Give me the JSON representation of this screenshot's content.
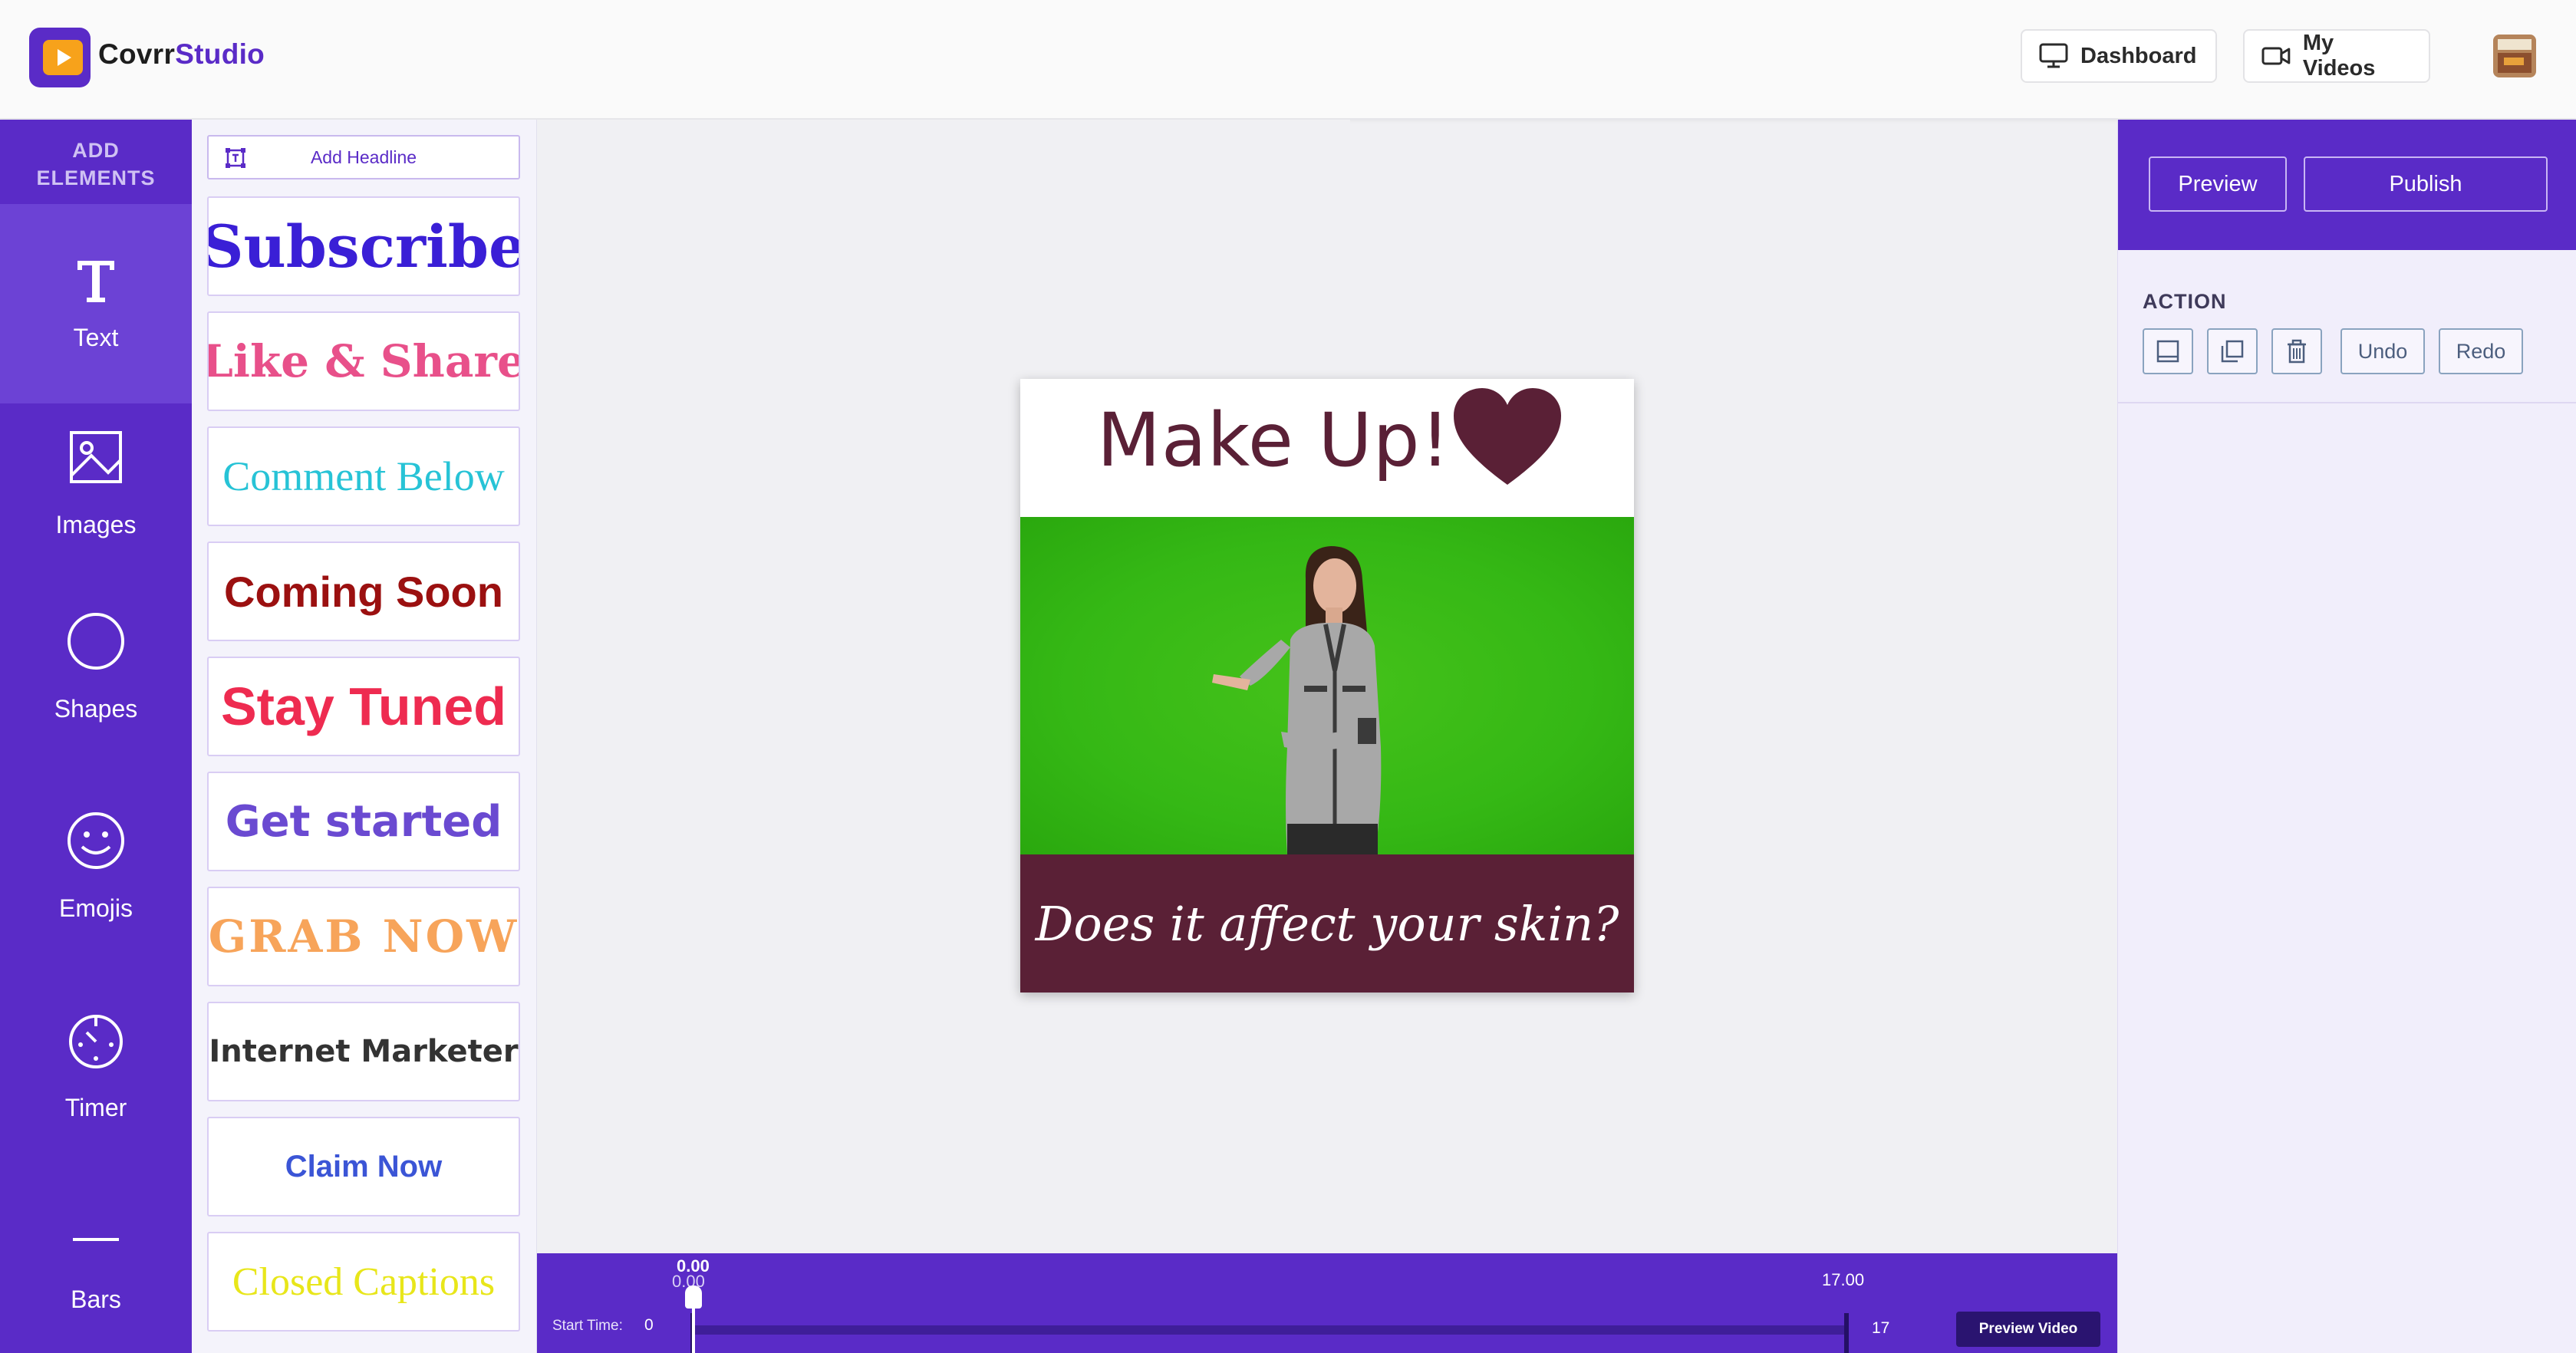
{
  "app": {
    "brand_left": "Covrr",
    "brand_right": "Studio"
  },
  "header": {
    "dashboard_label": "Dashboard",
    "my_videos_label": "My Videos"
  },
  "sidebar": {
    "heading_line1": "ADD",
    "heading_line2": "ELEMENTS",
    "items": [
      {
        "label": "Text",
        "icon": "text-icon"
      },
      {
        "label": "Images",
        "icon": "image-icon"
      },
      {
        "label": "Shapes",
        "icon": "circle-icon"
      },
      {
        "label": "Emojis",
        "icon": "smiley-icon"
      },
      {
        "label": "Timer",
        "icon": "timer-icon"
      },
      {
        "label": "Bars",
        "icon": "bar-icon"
      }
    ]
  },
  "panel": {
    "add_headline_label": "Add Headline",
    "templates": [
      {
        "text": "Subscribe",
        "color": "#3a1fd6"
      },
      {
        "text": "Like & Share",
        "color": "#e8508a"
      },
      {
        "text": "Comment Below",
        "color": "#27c3d6"
      },
      {
        "text": "Coming Soon",
        "color": "#9b1010"
      },
      {
        "text": "Stay Tuned",
        "color": "#ee2b50"
      },
      {
        "text": "Get started",
        "color": "#6a4ad1"
      },
      {
        "text": "GRAB NOW",
        "color": "#f7a45a"
      },
      {
        "text": "Internet Marketer",
        "color": "#333333"
      },
      {
        "text": "Claim Now",
        "color": "#3b55d6"
      },
      {
        "text": "Closed Captions",
        "color": "#e8e61a"
      }
    ]
  },
  "canvas": {
    "title": "Make Up!",
    "caption": "Does it affect your skin?",
    "accent_color": "#5a2036",
    "background_color": "#3cbf18"
  },
  "timeline": {
    "current_time": "0.00",
    "current_time_sub": "0.00",
    "end_time": "17.00",
    "start_time_label": "Start Time:",
    "start_time_value": "0",
    "end_value": "17",
    "preview_video_label": "Preview Video"
  },
  "right_panel": {
    "preview_label": "Preview",
    "publish_label": "Publish",
    "action_heading": "ACTION",
    "undo_label": "Undo",
    "redo_label": "Redo"
  },
  "colors": {
    "brand_purple": "#5a2bc7",
    "logo_orange": "#f7a21b"
  }
}
